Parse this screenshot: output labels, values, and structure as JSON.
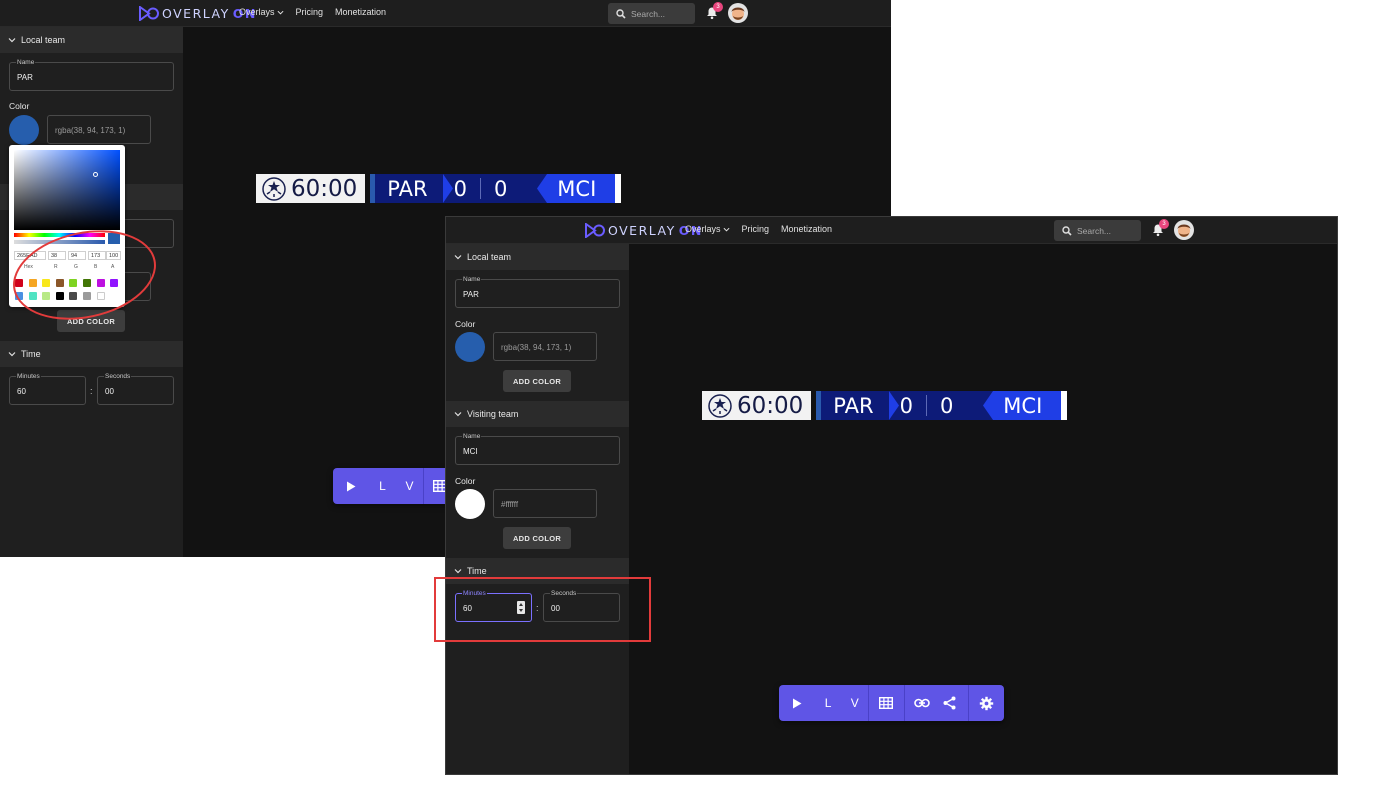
{
  "app": {
    "logo_text": "OVERLAY",
    "logo_on": "ON",
    "nav": {
      "overlays": "Overlays",
      "pricing": "Pricing",
      "monetization": "Monetization"
    },
    "search_placeholder": "Search...",
    "notifications_count": "3"
  },
  "sections": {
    "local_team": "Local team",
    "visiting_team": "Visiting team",
    "time": "Time"
  },
  "labels": {
    "name": "Name",
    "color": "Color",
    "add_color": "ADD COLOR",
    "minutes": "Minutes",
    "seconds": "Seconds",
    "colon": ":"
  },
  "local_team": {
    "name": "PAR",
    "color_value": "rgba(38, 94, 173, 1)",
    "swatch": "#265ead"
  },
  "visiting_team": {
    "name": "MCI",
    "color_value": "#ffffff",
    "swatch": "#ffffff"
  },
  "time": {
    "minutes": "60",
    "seconds": "00"
  },
  "scoreboard": {
    "clock": "60:00",
    "home": "PAR",
    "home_score": "0",
    "away_score": "0",
    "away": "MCI"
  },
  "toolbar": {
    "play": "play-icon",
    "local": "L",
    "visiting": "V",
    "grid": "grid-icon",
    "link": "link-icon",
    "share": "share-icon",
    "settings": "gear-icon"
  },
  "color_picker": {
    "hex": "265EAD",
    "r": "38",
    "g": "94",
    "b": "173",
    "a": "100",
    "labels": {
      "hex": "Hex",
      "r": "R",
      "g": "G",
      "b": "B",
      "a": "A"
    },
    "presets": [
      "#d0021b",
      "#f5a623",
      "#f8e71c",
      "#8b572a",
      "#7ed321",
      "#417505",
      "#bd10e0",
      "#9013fe",
      "#4a90e2",
      "#50e3c2",
      "#b8e986",
      "#000000",
      "#4a4a4a",
      "#9b9b9b",
      "#ffffff"
    ]
  },
  "colors": {
    "accent": "#5f55e6",
    "annotation": "#e23b3b"
  }
}
